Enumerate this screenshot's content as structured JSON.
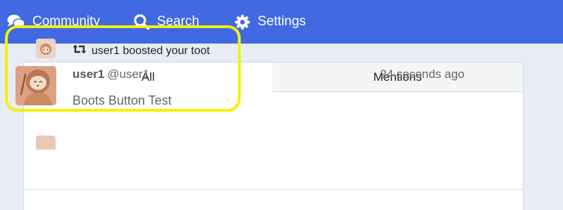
{
  "nav": {
    "community_label": "Community",
    "search_label": "Search",
    "settings_label": "Settings"
  },
  "tabs": [
    {
      "label": "All",
      "active": true
    },
    {
      "label": "Mentions",
      "active": false
    }
  ],
  "notification": {
    "boost_text": "user1 boosted your toot",
    "author_display": "user1",
    "author_handle": "@user1",
    "timestamp": "24 seconds ago",
    "content": "Boots Button Test"
  },
  "icons": {
    "community": "comments-icon",
    "search": "search-icon",
    "settings": "gear-icon",
    "boost": "retweet-icon"
  },
  "colors": {
    "topbar": "#4169e1",
    "background": "#e8ecf6",
    "highlight": "#f2f20a"
  }
}
